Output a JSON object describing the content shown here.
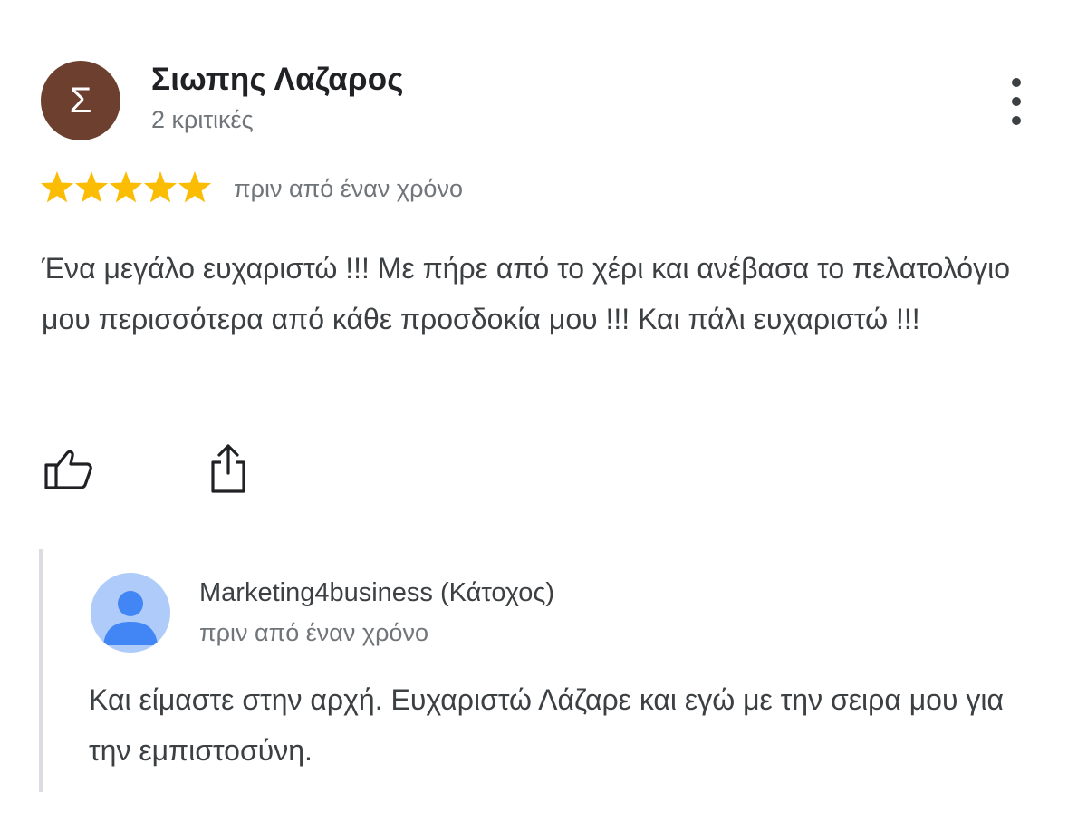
{
  "review": {
    "author": {
      "initial": "Σ",
      "name": "Σιωπης Λαζαρος",
      "review_count": "2 κριτικές",
      "avatar_color": "#6d3f2e"
    },
    "rating": 5,
    "rating_max": 5,
    "star_color": "#fbbc04",
    "time": "πριν από έναν χρόνο",
    "text": "Ένα μεγάλο ευχαριστώ !!! Με πήρε από το χέρι και ανέβασα το πελατολόγιο μου περισσότερα από κάθε προσδοκία μου !!! Και πάλι ευχαριστώ !!!",
    "actions": {
      "like_icon": "thumb-up-icon",
      "share_icon": "share-icon",
      "more_icon": "more-vert-icon"
    }
  },
  "owner_reply": {
    "name": "Marketing4business (Κάτοχος)",
    "time": "πριν από έναν χρόνο",
    "text": "Και είμαστε στην αρχή. Ευχαριστώ Λάζαρε και εγώ με την σειρα μου για την εμπιστοσύνη.",
    "avatar_icon": "person-icon"
  }
}
